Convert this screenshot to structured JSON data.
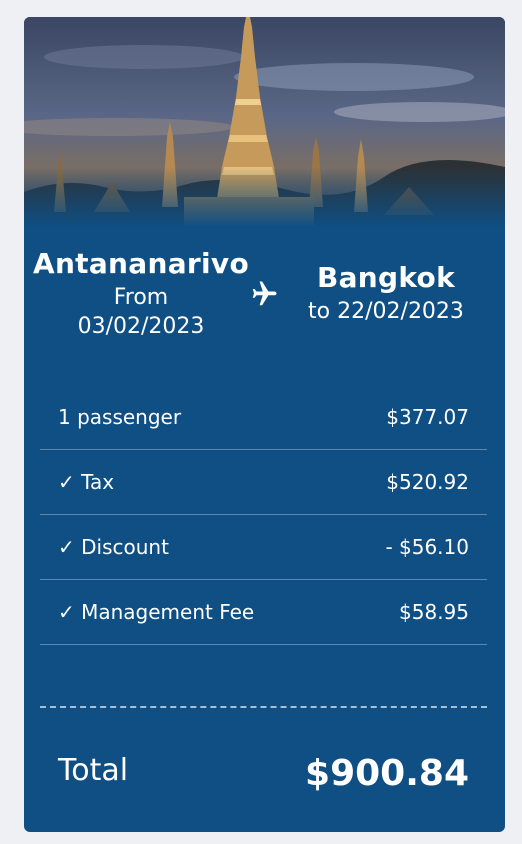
{
  "trip": {
    "origin_city": "Antananarivo",
    "origin_date_label": "From",
    "origin_date": "03/02/2023",
    "destination_city": "Bangkok",
    "destination_date_text": "to 22/02/2023"
  },
  "icons": {
    "plane": "airplane-icon",
    "check": "checkmark-icon"
  },
  "charges": [
    {
      "label": "1 passenger",
      "amount": "$377.07"
    },
    {
      "label": "✓ Tax",
      "amount": "$520.92"
    },
    {
      "label": "✓ Discount",
      "amount": "- $56.10"
    },
    {
      "label": "✓ Management Fee",
      "amount": "$58.95"
    }
  ],
  "total": {
    "label": "Total",
    "amount": "$900.84"
  },
  "colors": {
    "card_background": "#0f4f83",
    "page_background": "#eef0f4",
    "divider": "#5b88ad"
  }
}
